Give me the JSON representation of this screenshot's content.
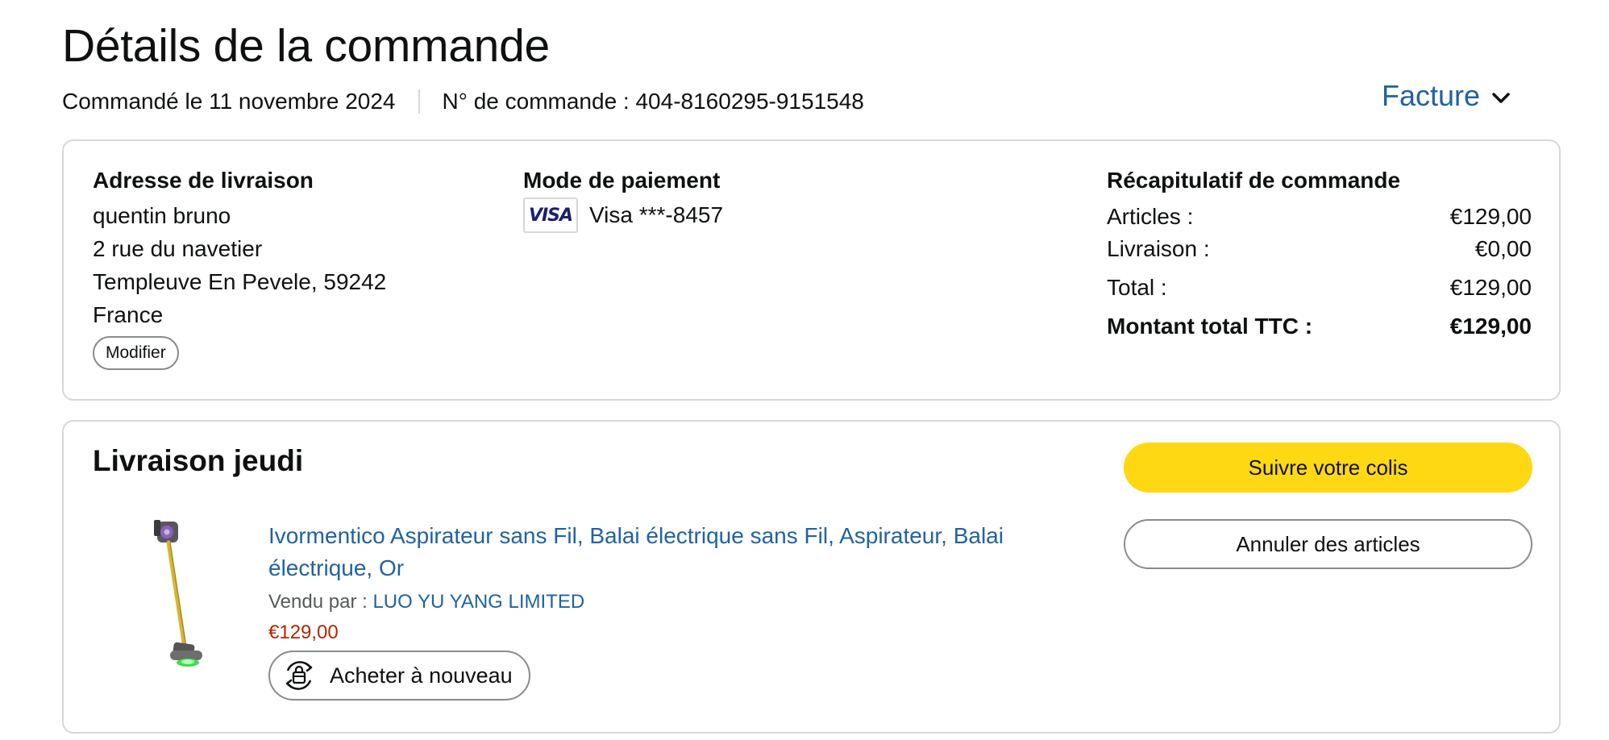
{
  "header": {
    "title": "Détails de la commande",
    "order_date": "Commandé le 11 novembre 2024",
    "order_number": "N° de commande : 404-8160295-9151548",
    "invoice_label": "Facture"
  },
  "shipping_address": {
    "heading": "Adresse de livraison",
    "name": "quentin bruno",
    "street": "2 rue du navetier",
    "city": "Templeuve En Pevele, 59242",
    "country": "France",
    "modify_label": "Modifier"
  },
  "payment": {
    "heading": "Mode de paiement",
    "card_brand": "VISA",
    "card_label": "Visa ***-8457"
  },
  "summary": {
    "heading": "Récapitulatif de commande",
    "rows": [
      {
        "label": "Articles :",
        "value": "€129,00"
      },
      {
        "label": "Livraison :",
        "value": "€0,00"
      },
      {
        "label": "Total :",
        "value": "€129,00"
      },
      {
        "label": "Montant total TTC :",
        "value": "€129,00"
      }
    ]
  },
  "shipment": {
    "title": "Livraison jeudi",
    "track_label": "Suivre votre colis",
    "cancel_label": "Annuler des articles",
    "product": {
      "title": "Ivormentico Aspirateur sans Fil, Balai électrique sans Fil, Aspirateur, Balai électrique, Or",
      "seller_prefix": "Vendu par : ",
      "seller_name": "LUO YU YANG LIMITED",
      "price": "€129,00",
      "buy_again_label": "Acheter à nouveau"
    }
  },
  "colors": {
    "link": "#2162a1",
    "price": "#b12704",
    "primary_button": "#ffd814",
    "border": "#d5d9d9"
  },
  "icons": [
    "chevron-down-icon",
    "visa-card-icon",
    "buy-again-icon",
    "vacuum-product-image"
  ]
}
